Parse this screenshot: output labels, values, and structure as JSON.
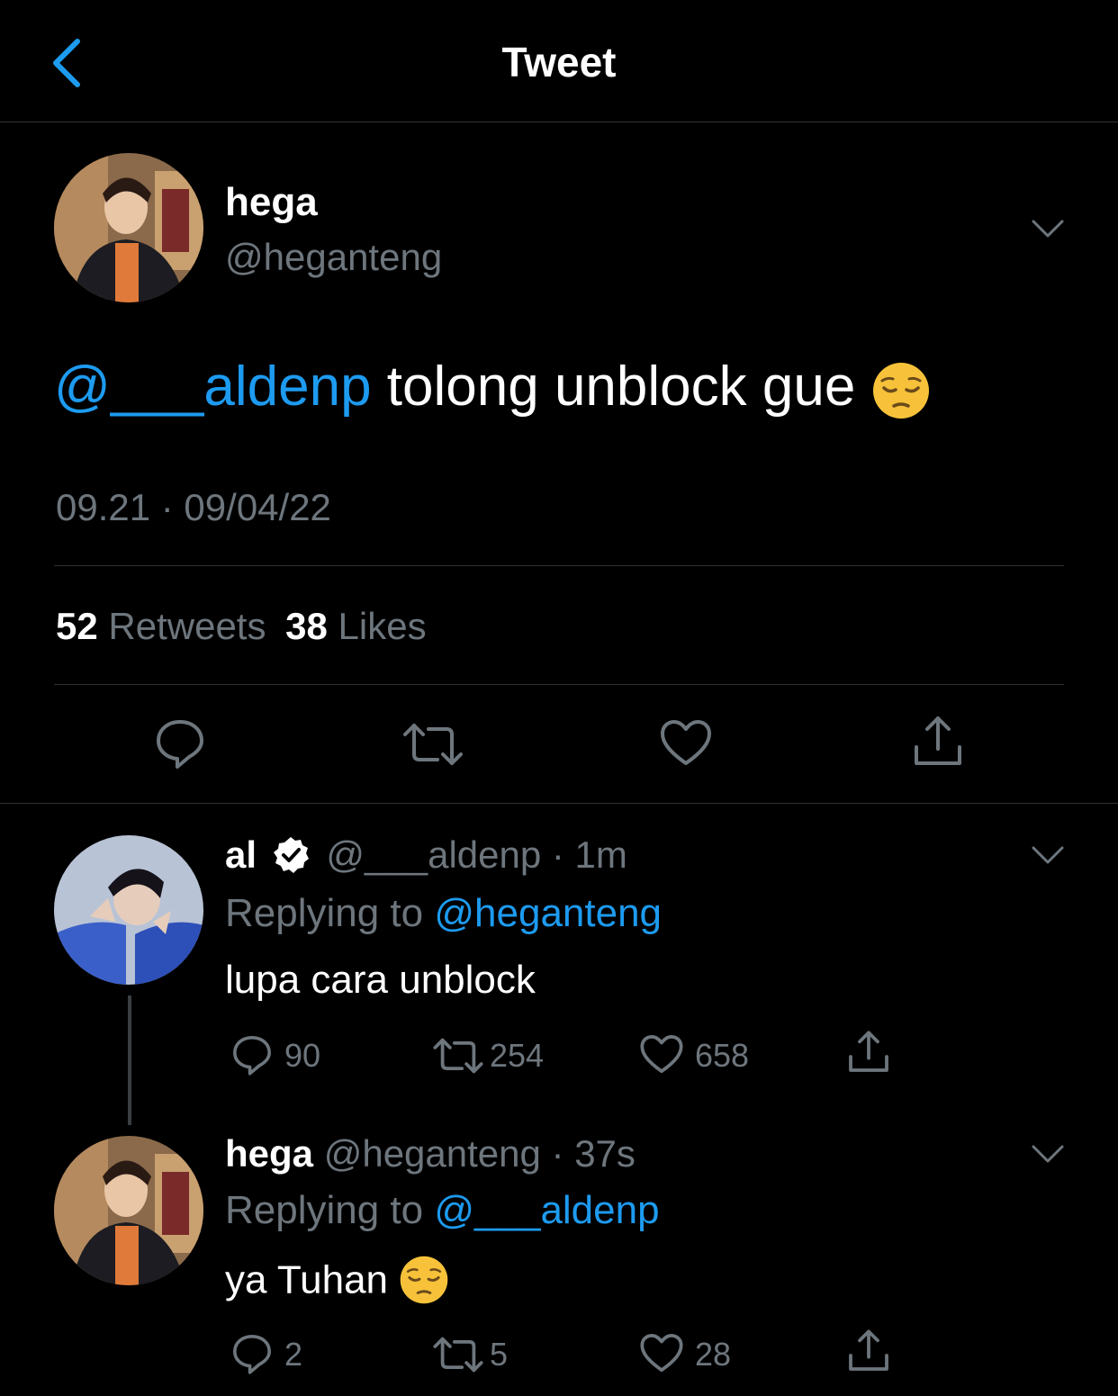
{
  "header": {
    "title": "Tweet",
    "back_icon": "chevron-left-icon"
  },
  "main_tweet": {
    "name": "hega",
    "handle": "@heganteng",
    "mention": "@___aldenp",
    "text": " tolong unblock gue ",
    "emoji": "pensive-face",
    "timestamp": "09.21 · 09/04/22",
    "retweets_count": "52",
    "retweets_label": "Retweets",
    "likes_count": "38",
    "likes_label": "Likes"
  },
  "replies": [
    {
      "name": "al",
      "verified": true,
      "handle_time": "@___aldenp · 1m",
      "replying_prefix": "Replying to ",
      "replying_to": "@heganteng",
      "text": "lupa cara unblock",
      "reply_count": "90",
      "retweet_count": "254",
      "like_count": "658"
    },
    {
      "name": "hega",
      "handle_time": "@heganteng · 37s",
      "replying_prefix": "Replying to ",
      "replying_to": "@___aldenp",
      "text": "ya Tuhan ",
      "emoji": "pensive-face",
      "reply_count": "2",
      "retweet_count": "5",
      "like_count": "28"
    }
  ],
  "colors": {
    "accent": "#1d9bf0",
    "muted": "#6e767d",
    "divider": "#2f3336",
    "background": "#000000"
  }
}
